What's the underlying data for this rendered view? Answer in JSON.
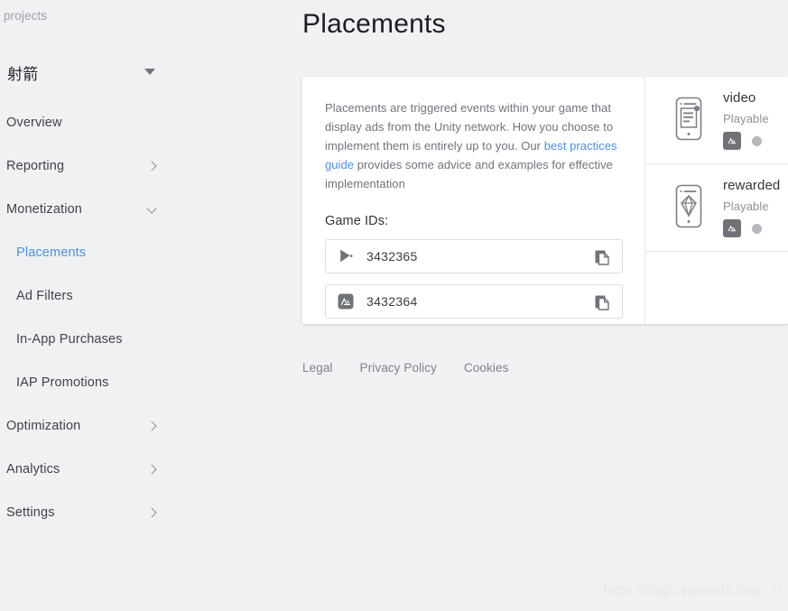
{
  "sidebar": {
    "breadcrumb": "ll projects",
    "project": {
      "name": "射箭",
      "caret_icon": "caret-down-icon"
    },
    "items": [
      {
        "label": "Overview",
        "level": "top",
        "chevron": "none",
        "active": false
      },
      {
        "label": "Reporting",
        "level": "top",
        "chevron": "right",
        "active": false
      },
      {
        "label": "Monetization",
        "level": "top",
        "chevron": "down",
        "active": false
      },
      {
        "label": "Placements",
        "level": "sub",
        "chevron": "none",
        "active": true
      },
      {
        "label": "Ad Filters",
        "level": "sub",
        "chevron": "none",
        "active": false
      },
      {
        "label": "In-App Purchases",
        "level": "sub",
        "chevron": "none",
        "active": false
      },
      {
        "label": "IAP Promotions",
        "level": "sub",
        "chevron": "none",
        "active": false
      },
      {
        "label": "Optimization",
        "level": "top",
        "chevron": "right",
        "active": false
      },
      {
        "label": "Analytics",
        "level": "top",
        "chevron": "right",
        "active": false
      },
      {
        "label": "Settings",
        "level": "top",
        "chevron": "right",
        "active": false
      }
    ]
  },
  "main": {
    "title": "Placements",
    "intro": {
      "part1": "Placements are triggered events within your game that display ads from the Unity network. How you choose to implement them is entirely up to you. Our ",
      "link": "best practices guide",
      "part2": " provides some advice and examples for effective implementation"
    },
    "game_ids": {
      "label": "Game IDs:",
      "fields": [
        {
          "platform": "google-play",
          "platform_icon": "google-play-icon",
          "value": "3432365",
          "copy_icon": "copy-icon"
        },
        {
          "platform": "app-store",
          "platform_icon": "app-store-icon",
          "value": "3432364",
          "copy_icon": "copy-icon"
        }
      ]
    },
    "placements": [
      {
        "name": "video",
        "type": "Playable",
        "device_icon": "phone-document-icon",
        "platform_icon": "app-store-icon",
        "status_color": "#b4b7bb"
      },
      {
        "name": "rewarded",
        "type": "Playable",
        "device_icon": "phone-diamond-icon",
        "platform_icon": "app-store-icon",
        "status_color": "#b4b7bb"
      }
    ]
  },
  "footer": {
    "links": [
      "Legal",
      "Privacy Policy",
      "Cookies"
    ]
  },
  "watermark": "https://blog.csdn.net/Libiao_Li",
  "colors": {
    "background": "#f0f1f3",
    "card": "#ffffff",
    "accent_link": "#4a90e2",
    "text_primary": "#1b1e23",
    "text_muted": "#6f747c",
    "border": "#dcdee2"
  }
}
